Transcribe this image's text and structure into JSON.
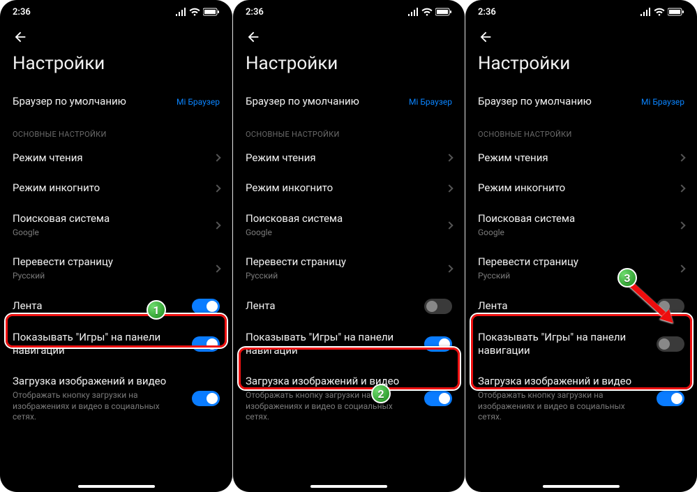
{
  "status": {
    "time": "2:36"
  },
  "screen": {
    "title": "Настройки",
    "default_browser": {
      "label": "Браузер по умолчанию",
      "value": "Mi Браузер"
    },
    "section_main": "ОСНОВНЫЕ НАСТРОЙКИ",
    "reading_mode": "Режим чтения",
    "incognito_mode": "Режим инкогнито",
    "search_engine": {
      "label": "Поисковая система",
      "value": "Google"
    },
    "translate": {
      "label": "Перевести страницу",
      "value": "Русский"
    },
    "feed": "Лента",
    "show_games": "Показывать \"Игры\" на панели навигации",
    "download_media": {
      "label": "Загрузка изображений и видео",
      "sub": "Отображать кнопку загрузки на изображениях и видео в социальных сетях."
    }
  },
  "panels": [
    {
      "feed_on": true,
      "games_on": true,
      "hi": "feed",
      "badge": "1"
    },
    {
      "feed_on": false,
      "games_on": true,
      "hi": "games",
      "badge": "2"
    },
    {
      "feed_on": false,
      "games_on": false,
      "hi": "both",
      "badge": "3"
    }
  ]
}
